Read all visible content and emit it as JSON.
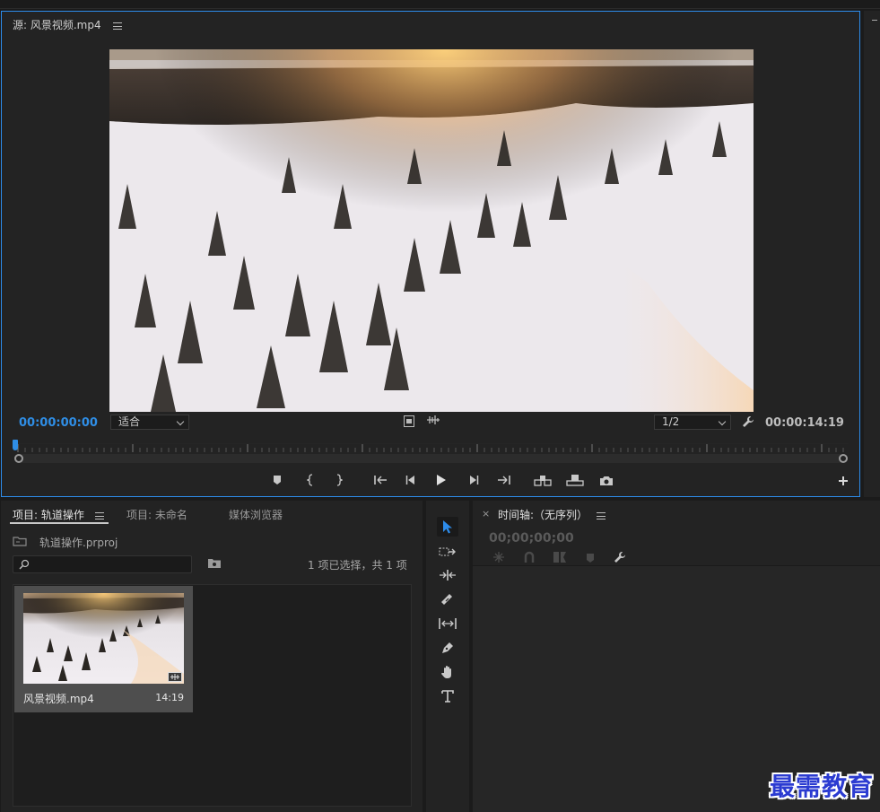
{
  "source": {
    "title": "源: 风景视频.mp4",
    "timecode_in": "00:00:00:00",
    "fit_label": "适合",
    "resolution_label": "1/2",
    "duration": "00:00:14:19"
  },
  "project": {
    "tabs": [
      "项目: 轨道操作",
      "项目: 未命名",
      "媒体浏览器"
    ],
    "file_name": "轨道操作.prproj",
    "search_placeholder": "",
    "selection_status": "1 项已选择，共 1 项",
    "clip": {
      "name": "风景视频.mp4",
      "duration": "14:19"
    }
  },
  "timeline": {
    "title": "时间轴:（无序列）",
    "timecode": "00;00;00;00"
  },
  "watermark": "最需教育",
  "colors": {
    "accent": "#2d8ceb",
    "panel": "#232323",
    "background": "#1b1b1b"
  }
}
